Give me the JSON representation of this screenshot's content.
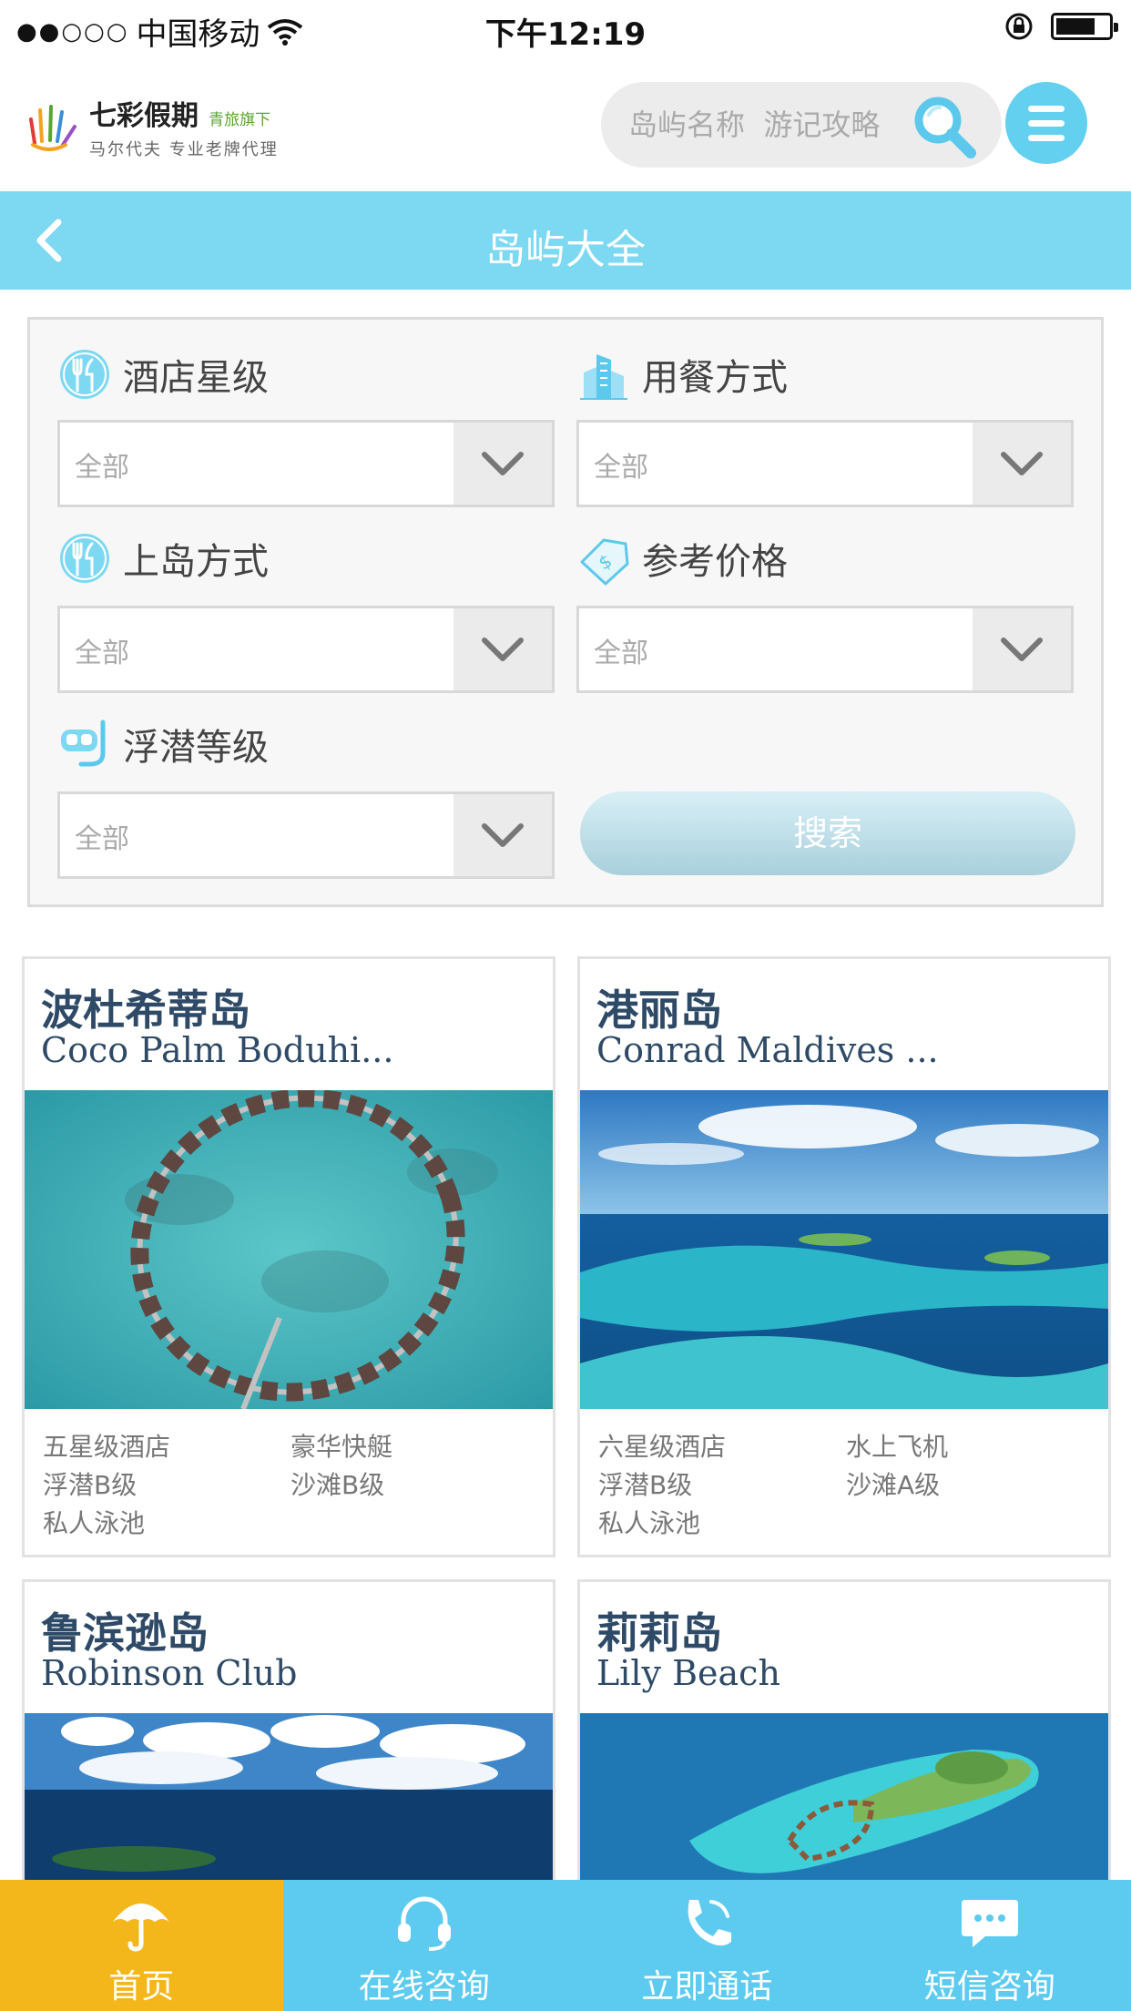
{
  "status_bar": {
    "carrier": "中国移动",
    "signal_dots": "●●○○○",
    "time": "下午12:19"
  },
  "header": {
    "logo": {
      "brand": "七彩假期",
      "sub_brand": "青旅旗下",
      "tagline": "马尔代夫 专业老牌代理"
    },
    "search": {
      "placeholder": "岛屿名称  游记攻略"
    }
  },
  "titlebar": {
    "title": "岛屿大全"
  },
  "filters": {
    "hotel_star": {
      "label": "酒店星级",
      "value": "全部",
      "icon": "fork-knife-icon"
    },
    "meal_plan": {
      "label": "用餐方式",
      "value": "全部",
      "icon": "building-icon"
    },
    "transfer": {
      "label": "上岛方式",
      "value": "全部",
      "icon": "fork-knife-icon"
    },
    "price": {
      "label": "参考价格",
      "value": "全部",
      "icon": "price-tag-icon"
    },
    "snorkel": {
      "label": "浮潜等级",
      "value": "全部",
      "icon": "snorkel-mask-icon"
    },
    "search_button": "搜索"
  },
  "islands": [
    {
      "name_cn": "波杜希蒂岛",
      "name_en": "Coco Palm Boduhi...",
      "features": [
        "五星级酒店",
        "豪华快艇",
        "浮潜B级",
        "沙滩B级",
        "私人泳池"
      ]
    },
    {
      "name_cn": "港丽岛",
      "name_en": "Conrad Maldives ...",
      "features": [
        "六星级酒店",
        "水上飞机",
        "浮潜B级",
        "沙滩A级",
        "私人泳池"
      ]
    },
    {
      "name_cn": "鲁滨逊岛",
      "name_en": "Robinson Club"
    },
    {
      "name_cn": "莉莉岛",
      "name_en": "Lily Beach"
    }
  ],
  "bottom_nav": [
    {
      "label": "首页",
      "icon": "umbrella-icon",
      "active": true
    },
    {
      "label": "在线咨询",
      "icon": "headset-icon",
      "active": false
    },
    {
      "label": "立即通话",
      "icon": "phone-icon",
      "active": false
    },
    {
      "label": "短信咨询",
      "icon": "chat-bubble-icon",
      "active": false
    }
  ],
  "colors": {
    "accent": "#7dd8f2",
    "nav_bg": "#5dcbef",
    "nav_active": "#f4b71b",
    "island_title": "#2e4a66"
  }
}
